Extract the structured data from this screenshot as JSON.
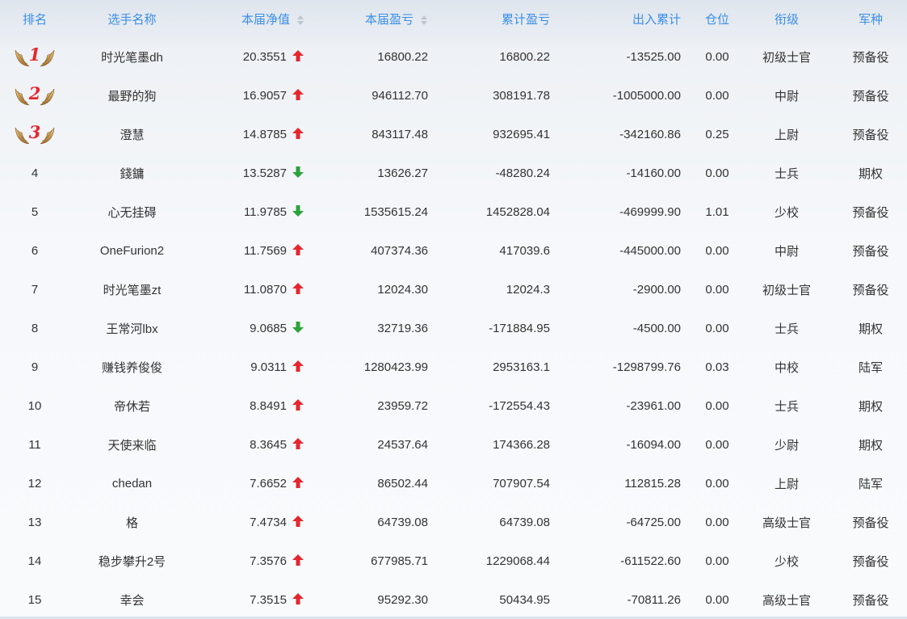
{
  "headers": {
    "rank": "排名",
    "name": "选手名称",
    "net_value": "本届净值",
    "profit": "本届盈亏",
    "cum_profit": "累计盈亏",
    "flow": "出入累计",
    "position": "仓位",
    "grade": "衔级",
    "branch": "军种"
  },
  "colors": {
    "header_text": "#3a8ee6",
    "up_arrow": "#e5262e",
    "down_arrow": "#2aa33a",
    "medal_number": "#e5262e"
  },
  "rows": [
    {
      "rank": "1",
      "name": "时光笔墨dh",
      "net_value": "20.3551",
      "trend": "up",
      "profit": "16800.22",
      "cum_profit": "16800.22",
      "flow": "-13525.00",
      "position": "0.00",
      "grade": "初级士官",
      "branch": "预备役"
    },
    {
      "rank": "2",
      "name": "最野的狗",
      "net_value": "16.9057",
      "trend": "up",
      "profit": "946112.70",
      "cum_profit": "308191.78",
      "flow": "-1005000.00",
      "position": "0.00",
      "grade": "中尉",
      "branch": "预备役"
    },
    {
      "rank": "3",
      "name": "澄慧",
      "net_value": "14.8785",
      "trend": "up",
      "profit": "843117.48",
      "cum_profit": "932695.41",
      "flow": "-342160.86",
      "position": "0.25",
      "grade": "上尉",
      "branch": "预备役"
    },
    {
      "rank": "4",
      "name": "錢鏞",
      "net_value": "13.5287",
      "trend": "down",
      "profit": "13626.27",
      "cum_profit": "-48280.24",
      "flow": "-14160.00",
      "position": "0.00",
      "grade": "士兵",
      "branch": "期权"
    },
    {
      "rank": "5",
      "name": "心无挂碍",
      "net_value": "11.9785",
      "trend": "down",
      "profit": "1535615.24",
      "cum_profit": "1452828.04",
      "flow": "-469999.90",
      "position": "1.01",
      "grade": "少校",
      "branch": "预备役"
    },
    {
      "rank": "6",
      "name": "OneFurion2",
      "net_value": "11.7569",
      "trend": "up",
      "profit": "407374.36",
      "cum_profit": "417039.6",
      "flow": "-445000.00",
      "position": "0.00",
      "grade": "中尉",
      "branch": "预备役"
    },
    {
      "rank": "7",
      "name": "时光笔墨zt",
      "net_value": "11.0870",
      "trend": "up",
      "profit": "12024.30",
      "cum_profit": "12024.3",
      "flow": "-2900.00",
      "position": "0.00",
      "grade": "初级士官",
      "branch": "预备役"
    },
    {
      "rank": "8",
      "name": "王常河lbx",
      "net_value": "9.0685",
      "trend": "down",
      "profit": "32719.36",
      "cum_profit": "-171884.95",
      "flow": "-4500.00",
      "position": "0.00",
      "grade": "士兵",
      "branch": "期权"
    },
    {
      "rank": "9",
      "name": "赚钱养俊俊",
      "net_value": "9.0311",
      "trend": "up",
      "profit": "1280423.99",
      "cum_profit": "2953163.1",
      "flow": "-1298799.76",
      "position": "0.03",
      "grade": "中校",
      "branch": "陆军"
    },
    {
      "rank": "10",
      "name": "帝休若",
      "net_value": "8.8491",
      "trend": "up",
      "profit": "23959.72",
      "cum_profit": "-172554.43",
      "flow": "-23961.00",
      "position": "0.00",
      "grade": "士兵",
      "branch": "期权"
    },
    {
      "rank": "11",
      "name": "天使来临",
      "net_value": "8.3645",
      "trend": "up",
      "profit": "24537.64",
      "cum_profit": "174366.28",
      "flow": "-16094.00",
      "position": "0.00",
      "grade": "少尉",
      "branch": "期权"
    },
    {
      "rank": "12",
      "name": "chedan",
      "net_value": "7.6652",
      "trend": "up",
      "profit": "86502.44",
      "cum_profit": "707907.54",
      "flow": "112815.28",
      "position": "0.00",
      "grade": "上尉",
      "branch": "陆军"
    },
    {
      "rank": "13",
      "name": "格",
      "net_value": "7.4734",
      "trend": "up",
      "profit": "64739.08",
      "cum_profit": "64739.08",
      "flow": "-64725.00",
      "position": "0.00",
      "grade": "高级士官",
      "branch": "预备役"
    },
    {
      "rank": "14",
      "name": "稳步攀升2号",
      "net_value": "7.3576",
      "trend": "up",
      "profit": "677985.71",
      "cum_profit": "1229068.44",
      "flow": "-611522.60",
      "position": "0.00",
      "grade": "少校",
      "branch": "预备役"
    },
    {
      "rank": "15",
      "name": "幸会",
      "net_value": "7.3515",
      "trend": "up",
      "profit": "95292.30",
      "cum_profit": "50434.95",
      "flow": "-70811.26",
      "position": "0.00",
      "grade": "高级士官",
      "branch": "预备役"
    }
  ]
}
